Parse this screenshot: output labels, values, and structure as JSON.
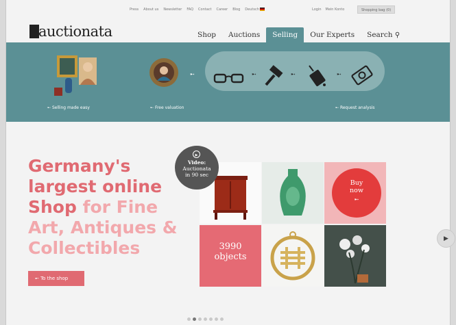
{
  "topbar": {
    "links": [
      "Press",
      "About us",
      "Newsletter",
      "FAQ",
      "Contact",
      "Career",
      "Blog",
      "Deutsch"
    ],
    "login": "Login",
    "my_account": "Mein Konto",
    "shopping_bag": "Shopping bag (0)"
  },
  "logo": {
    "text": "auctionata"
  },
  "nav": [
    {
      "label": "Shop",
      "active": false
    },
    {
      "label": "Auctions",
      "active": false
    },
    {
      "label": "Selling",
      "active": true
    },
    {
      "label": "Our Experts",
      "active": false
    },
    {
      "label": "Search",
      "active": false
    }
  ],
  "banner": {
    "items": [
      {
        "label": "Selling made easy"
      },
      {
        "label": "Free valuation"
      },
      {
        "label": "Request analysis"
      }
    ],
    "step_icons": [
      "glasses-icon",
      "gavel-icon",
      "luggage-icon",
      "money-icon"
    ],
    "colors": {
      "banner": "#5b9095",
      "oval": "#8ab1b3"
    }
  },
  "hero": {
    "line1": "Germany's",
    "line2": "largest online",
    "line3a": "Shop ",
    "line3b": "for Fine",
    "line4": "Art, Antiques &",
    "line5": "Collectibles",
    "cta": "To the shop"
  },
  "tiles": {
    "video_title": "Video:",
    "video_sub1": "Auctionata",
    "video_sub2": "in 90 sec",
    "buy1": "Buy",
    "buy2": "now",
    "objects_count": "3990",
    "objects_label": "objects"
  },
  "carousel": {
    "dots": 7,
    "active": 1
  },
  "colors": {
    "accent": "#e06a72",
    "teal": "#5b9095",
    "red": "#e33c3c"
  }
}
